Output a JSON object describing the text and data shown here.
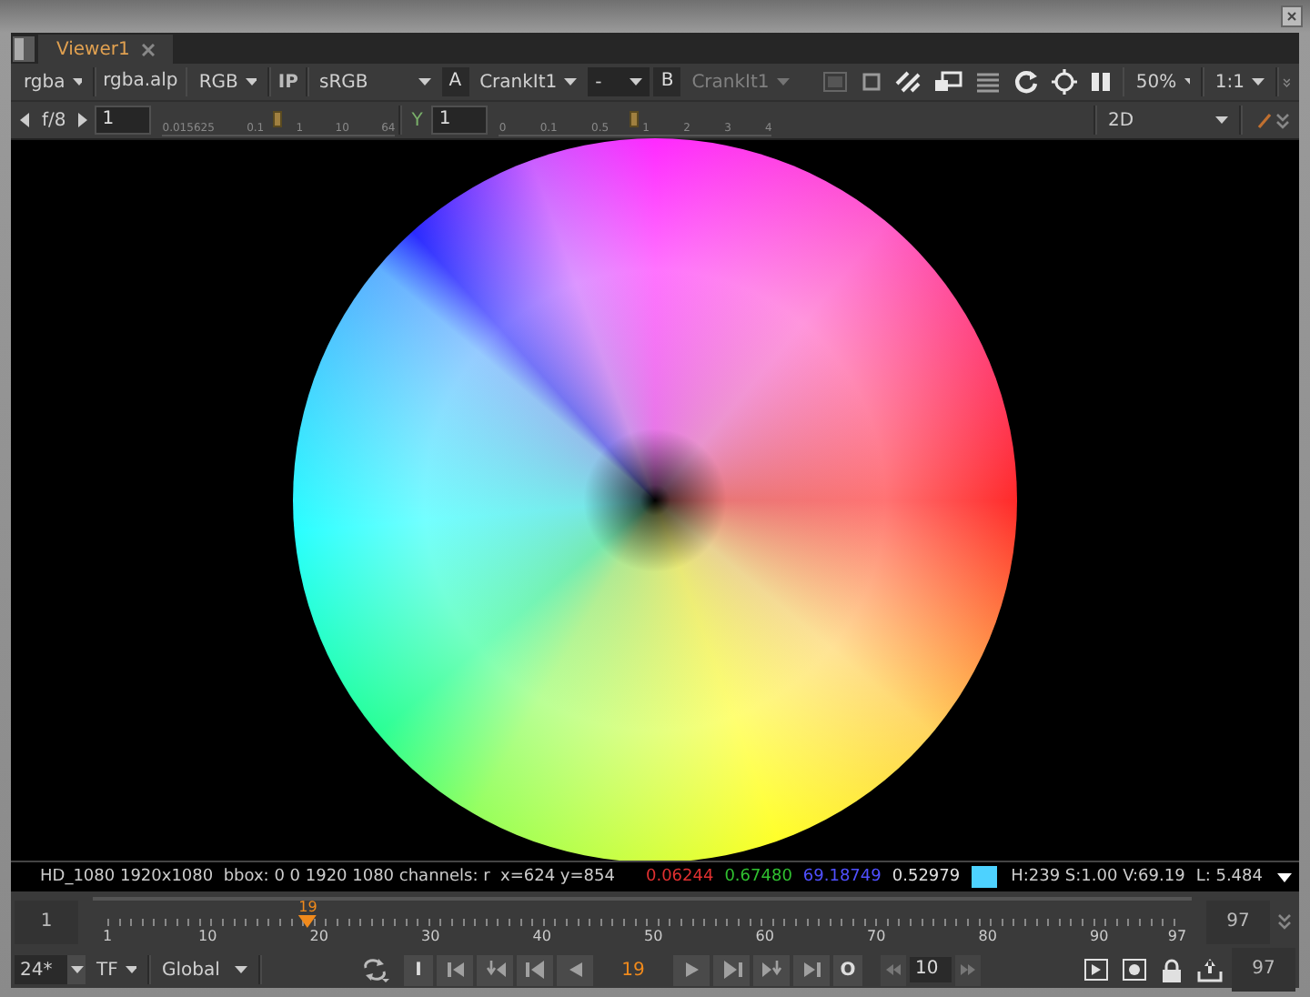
{
  "tabs": [
    {
      "label": "Viewer1",
      "selected": true
    }
  ],
  "viewer_toolbar": {
    "channels": "rgba",
    "alpha_channel": "rgba.alp",
    "display_channels": "RGB",
    "ip_button": "IP",
    "lut": "sRGB",
    "input_a": {
      "label": "A",
      "node": "CrankIt1"
    },
    "wipe_mode": "-",
    "input_b": {
      "label": "B",
      "node": "CrankIt1",
      "disabled": true
    },
    "zoom": "50%",
    "proxy": "1:1"
  },
  "exposure_bar": {
    "gain": {
      "label": "f/8",
      "value": "1",
      "level": 0.49,
      "ticks": [
        "0.015625",
        "0.1",
        "1",
        "10",
        "64"
      ]
    },
    "gamma": {
      "label": "Y",
      "value": "1",
      "level": 0.49,
      "ticks": [
        "0",
        "0.1",
        "0.5",
        "1",
        "2",
        "3",
        "4"
      ]
    },
    "view_mode": "2D"
  },
  "status_bar": {
    "info": "HD_1080 1920x1080  bbox: 0 0 1920 1080 channels: r  x=624 y=854",
    "pixel_values": [
      {
        "kind": "value",
        "text": "0.06244",
        "color": "#e03030"
      },
      {
        "kind": "value",
        "text": "0.67480",
        "color": "#30c030"
      },
      {
        "kind": "value",
        "text": "69.18749",
        "color": "#5050ff"
      },
      {
        "kind": "value",
        "text": "0.52979",
        "color": "#e0e0e0"
      },
      {
        "kind": "swatch",
        "color": "#4dd2ff"
      }
    ],
    "hsv": "H:239 S:1.00 V:69.19",
    "luminance": "L: 5.484"
  },
  "timeline": {
    "in_frame": "1",
    "out_frame": "97",
    "current": "19",
    "level": 0.1875,
    "ticks": [
      "1",
      "10",
      "20",
      "30",
      "40",
      "50",
      "60",
      "70",
      "80",
      "90",
      "97"
    ]
  },
  "playback": {
    "fps": "24*",
    "time_format": "TF",
    "range": "Global",
    "in_button": "I",
    "frame": "19",
    "out_button": "O",
    "increment": "10",
    "end_frame": "97"
  }
}
